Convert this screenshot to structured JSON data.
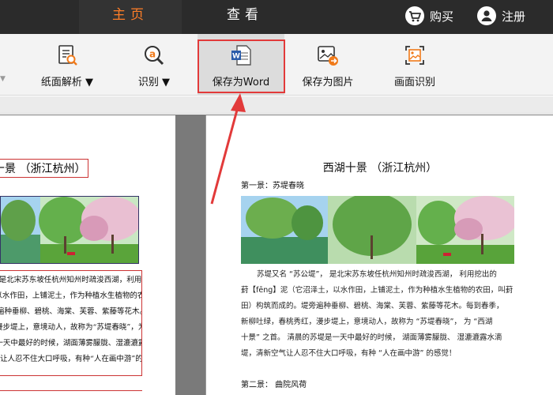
{
  "topbar": {
    "tabs": [
      {
        "label": "主页"
      },
      {
        "label": "查看"
      }
    ],
    "buy_label": "购买",
    "register_label": "注册"
  },
  "ribbon": {
    "buttons": [
      {
        "label": "纸面解析 ▼",
        "icon": "document-search-icon"
      },
      {
        "label": "识别 ▼",
        "icon": "ocr-icon"
      },
      {
        "label": "保存为Word",
        "icon": "word-icon"
      },
      {
        "label": "保存为图片",
        "icon": "image-export-icon"
      },
      {
        "label": "画面识别",
        "icon": "screen-capture-icon"
      }
    ]
  },
  "source_page": {
    "title": "西湖十景 （浙江杭州）",
    "lines": [
      "苏堤又名“苏公堤”，是北宋苏东坡任杭州知州时疏浚西湖，利用挖出的",
      "葑【fēng】泥（它沼泽土，以水作田，上铺泥土，作为种植水生植物的农田，叫葑",
      "田）构筑而成的。堤旁遍种垂柳、碧桃、海棠、芙蓉、紫藤等花木。每到春季，",
      "新柳吐绿，春桃秀红，漫步堤上，意境动人，故称为“苏堤春晓”，为“西湖",
      "十景”之首。清晨的苏堤是一天中最好的时候，湖面薄雾朦胧、湿漉漉露水滴",
      "堤，清新空气让人忍不住大口呼吸，有种“人在画中游”的感觉！"
    ]
  },
  "converted_page": {
    "title": "西湖十景 （浙江杭州）",
    "subtitle": "第一景：苏堤春晓",
    "lines": [
      "苏堤又名 “苏公堤”， 是北宋苏东坡任杭州知州时疏浚西湖， 利用挖出的",
      "葑【fēng】泥（它沼泽土，以水作田，上铺泥土，作为种植水生植物的农田，叫葑",
      "田）构筑而成的。堤旁遍种垂柳、碧桃、海棠、芙蓉、紫藤等花木。每到春季，",
      "新柳吐绿，春桃秀红，漫步堤上，意境动人，故称为 “苏堤春晓”， 为 “西湖",
      "十景” 之首。 清晨的苏堤是一天中最好的时候， 湖面薄雾朦胧、 湿漉漉露水滴",
      "堤，清新空气让人忍不住大口呼吸，有种 “人在画中游” 的感觉！"
    ],
    "next_heading": "第二景：  曲院风荷"
  },
  "colors": {
    "topbar_bg": "#2b2b2b",
    "active_tab_text": "#ff7e27",
    "highlight_red": "#e23a3a"
  }
}
